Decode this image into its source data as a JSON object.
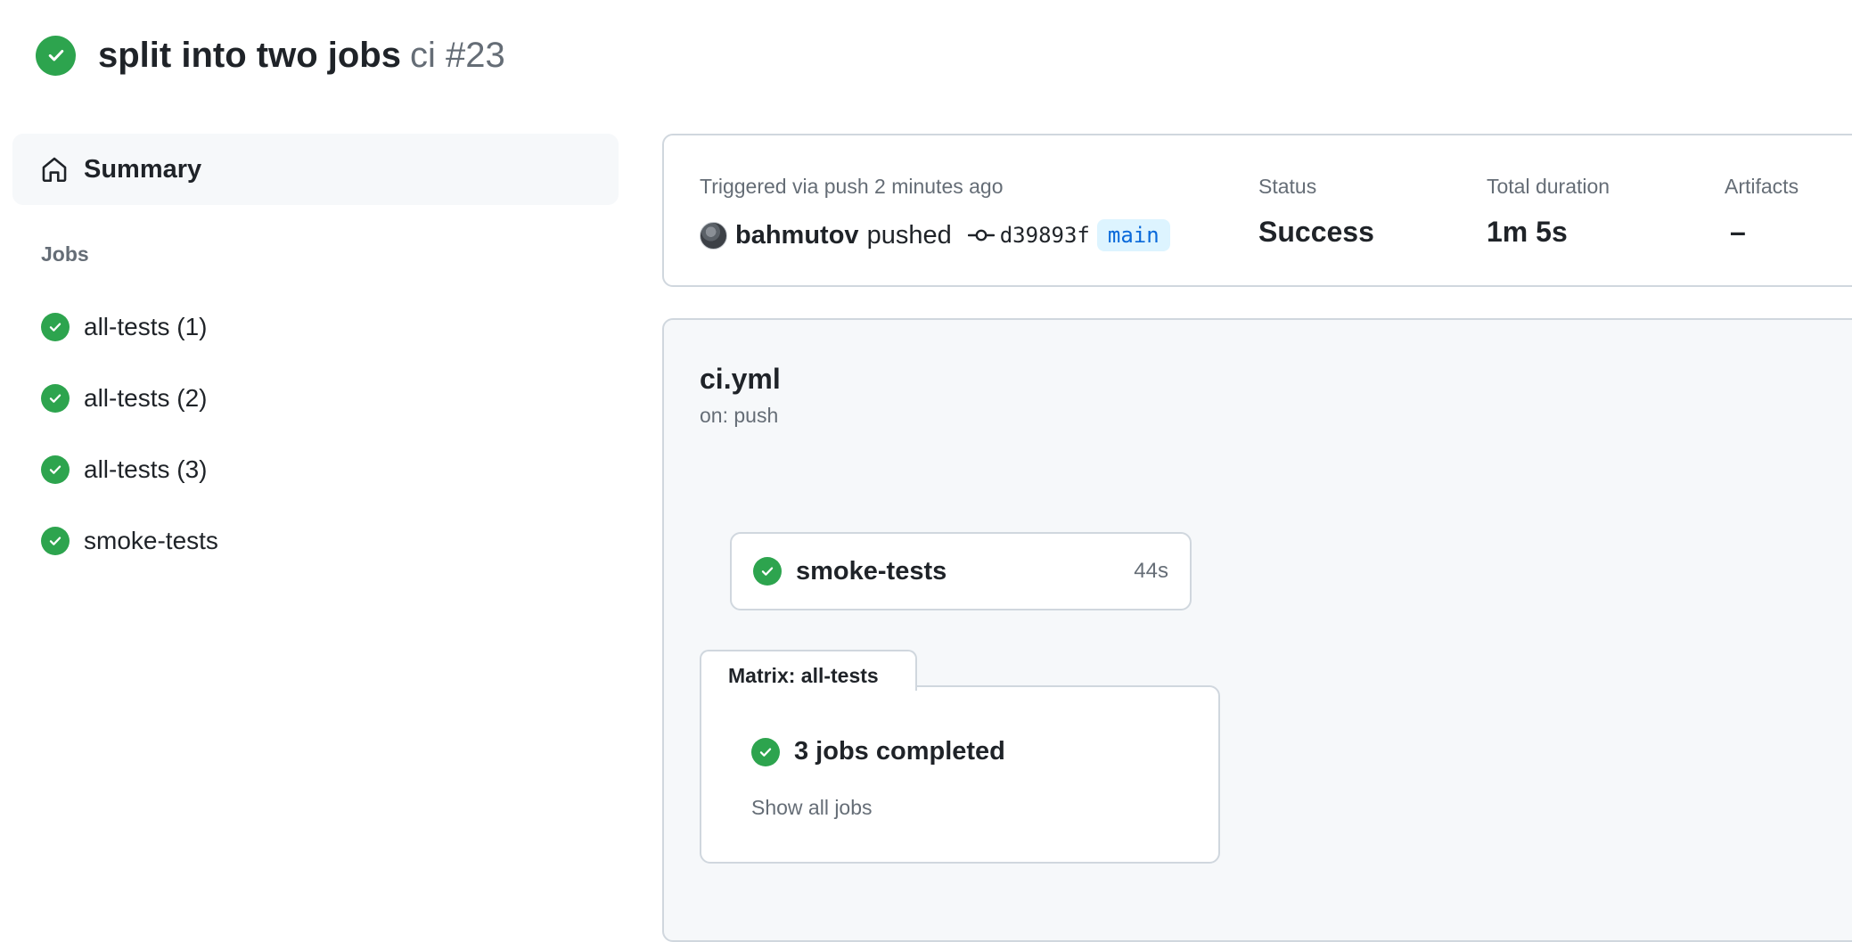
{
  "run": {
    "title": "split into two jobs",
    "subtitle": "ci #23",
    "status_icon": "check-circle-fill-icon",
    "status_color": "#2da44e"
  },
  "sidebar": {
    "summary_label": "Summary",
    "jobs_heading": "Jobs",
    "jobs": [
      {
        "label": "all-tests (1)",
        "status": "success"
      },
      {
        "label": "all-tests (2)",
        "status": "success"
      },
      {
        "label": "all-tests (3)",
        "status": "success"
      },
      {
        "label": "smoke-tests",
        "status": "success"
      }
    ]
  },
  "summary_card": {
    "trigger_text": "Triggered via push 2 minutes ago",
    "actor": "bahmutov",
    "action": "pushed",
    "commit_sha": "d39893f",
    "branch": "main",
    "status_label": "Status",
    "status_value": "Success",
    "duration_label": "Total duration",
    "duration_value": "1m 5s",
    "artifacts_label": "Artifacts",
    "artifacts_value": "–"
  },
  "workflow": {
    "file_name": "ci.yml",
    "trigger": "on: push",
    "job_node": {
      "name": "smoke-tests",
      "duration": "44s"
    },
    "matrix": {
      "tab_label": "Matrix: all-tests",
      "summary": "3 jobs completed",
      "show_all": "Show all jobs"
    }
  },
  "colors": {
    "success": "#2da44e",
    "link": "#0969da",
    "branch_bg": "#ddf4ff",
    "muted_text": "#656d76",
    "border": "#d0d7de",
    "panel_bg": "#f6f8fa"
  }
}
